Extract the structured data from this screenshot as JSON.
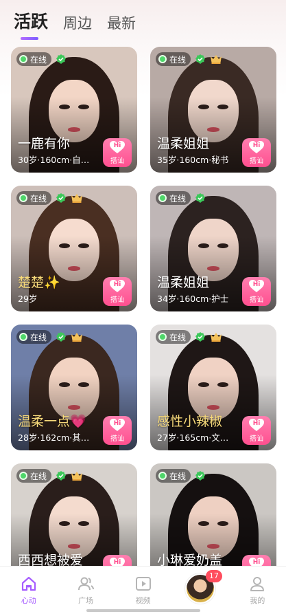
{
  "tabs": [
    {
      "label": "活跃",
      "active": true
    },
    {
      "label": "周边",
      "active": false
    },
    {
      "label": "最新",
      "active": false
    }
  ],
  "online_label": "在线",
  "hi_label": "Hi",
  "chat_label": "搭讪",
  "colors": {
    "accent": "#a65dff",
    "pink": "#ff5c95",
    "online": "#4fd66a",
    "badge": "#ff4d5e"
  },
  "profiles": [
    {
      "name": "一鹿有你",
      "meta": "30岁·160cm·自…",
      "verified": true,
      "crown": false,
      "gold": false
    },
    {
      "name": "温柔姐姐",
      "meta": "35岁·160cm·秘书",
      "verified": true,
      "crown": true,
      "gold": false
    },
    {
      "name": "楚楚✨",
      "meta": "29岁",
      "verified": true,
      "crown": true,
      "gold": true
    },
    {
      "name": "温柔姐姐",
      "meta": "34岁·160cm·护士",
      "verified": true,
      "crown": false,
      "gold": false
    },
    {
      "name": "温柔一点💗",
      "meta": "28岁·162cm·其…",
      "verified": true,
      "crown": true,
      "gold": true
    },
    {
      "name": "感性小辣椒",
      "meta": "27岁·165cm·文…",
      "verified": true,
      "crown": true,
      "gold": true
    },
    {
      "name": "西西想被爱",
      "meta": "",
      "verified": true,
      "crown": true,
      "gold": false
    },
    {
      "name": "小琳爱奶盖",
      "meta": "",
      "verified": true,
      "crown": false,
      "gold": false
    }
  ],
  "tabbar": [
    {
      "label": "心动",
      "icon": "home-icon",
      "active": true
    },
    {
      "label": "广场",
      "icon": "users-icon",
      "active": false
    },
    {
      "label": "视频",
      "icon": "video-icon",
      "active": false
    },
    {
      "label": "",
      "icon": "message-avatar",
      "active": false,
      "badge": "17"
    },
    {
      "label": "我的",
      "icon": "profile-icon",
      "active": false
    }
  ]
}
